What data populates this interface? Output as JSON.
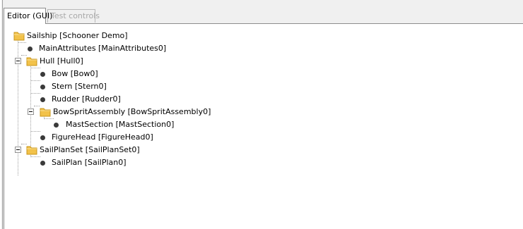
{
  "tabs": [
    {
      "label": "Editor (GUI)",
      "state": "active"
    },
    {
      "label": "Test controls",
      "state": "disabled"
    }
  ],
  "tree": {
    "root": {
      "label": "Sailship [Schooner Demo]",
      "icon": "folder-icon"
    },
    "items": [
      {
        "label": "MainAttributes [MainAttributes0]",
        "icon": "bullet-icon"
      },
      {
        "label": "Hull [Hull0]",
        "icon": "folder-icon",
        "expanded": true
      },
      {
        "label": "Bow [Bow0]",
        "icon": "bullet-icon"
      },
      {
        "label": "Stern [Stern0]",
        "icon": "bullet-icon"
      },
      {
        "label": "Rudder [Rudder0]",
        "icon": "bullet-icon"
      },
      {
        "label": "BowSpritAssembly [BowSpritAssembly0]",
        "icon": "folder-icon",
        "expanded": true
      },
      {
        "label": "MastSection [MastSection0]",
        "icon": "bullet-icon"
      },
      {
        "label": "FigureHead [FigureHead0]",
        "icon": "bullet-icon"
      },
      {
        "label": "SailPlanSet [SailPlanSet0]",
        "icon": "folder-icon",
        "expanded": true
      },
      {
        "label": "SailPlan [SailPlan0]",
        "icon": "bullet-icon"
      }
    ]
  },
  "colors": {
    "folder_fill": "#f2c24a",
    "folder_shadow": "#d9a21c",
    "window_bg": "#f0f0f0",
    "panel_bg": "#ffffff"
  }
}
